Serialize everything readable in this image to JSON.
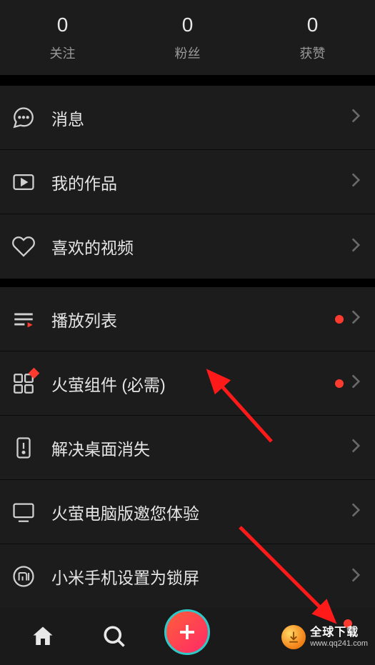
{
  "stats": [
    {
      "value": "0",
      "label": "关注"
    },
    {
      "value": "0",
      "label": "粉丝"
    },
    {
      "value": "0",
      "label": "获赞"
    }
  ],
  "group1": {
    "messages": "消息",
    "myWorks": "我的作品",
    "liked": "喜欢的视频"
  },
  "group2": {
    "playlist": "播放列表",
    "widget": "火萤组件 (必需)",
    "desktopFix": "解决桌面消失",
    "pcVersion": "火萤电脑版邀您体验",
    "xiaomi": "小米手机设置为锁屏"
  },
  "watermark": {
    "title": "全球下载",
    "sub": "www.qq241.com"
  }
}
